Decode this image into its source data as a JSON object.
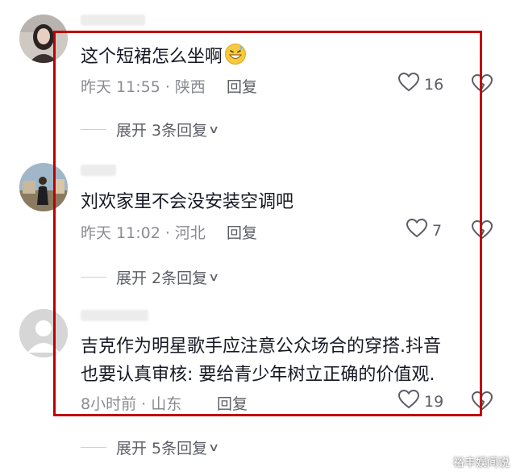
{
  "comments": [
    {
      "text": "这个短裙怎么坐啊",
      "emoji": "grinning-sweat-emoji",
      "time": "昨天 11:55",
      "location": "陕西",
      "reply_label": "回复",
      "likes": "16",
      "expand_label": "展开 3条回复"
    },
    {
      "text": "刘欢家里不会没安装空调吧",
      "time": "昨天 11:02",
      "location": "河北",
      "reply_label": "回复",
      "likes": "7",
      "expand_label": "展开 2条回复"
    },
    {
      "text_line1": "吉克作为明星歌手应注意公众场合的穿搭.抖音",
      "text_line2": "也要认真审核: 要给青少年树立正确的价值观.",
      "time": "8小时前",
      "location": "山东",
      "reply_label": "回复",
      "likes": "19",
      "expand_label": "展开 5条回复"
    }
  ],
  "watermark": "裕丰娱间说",
  "colors": {
    "highlight_border": "#c00000",
    "text": "#161823",
    "meta": "#8a8b91",
    "secondary": "#5c5e66"
  }
}
